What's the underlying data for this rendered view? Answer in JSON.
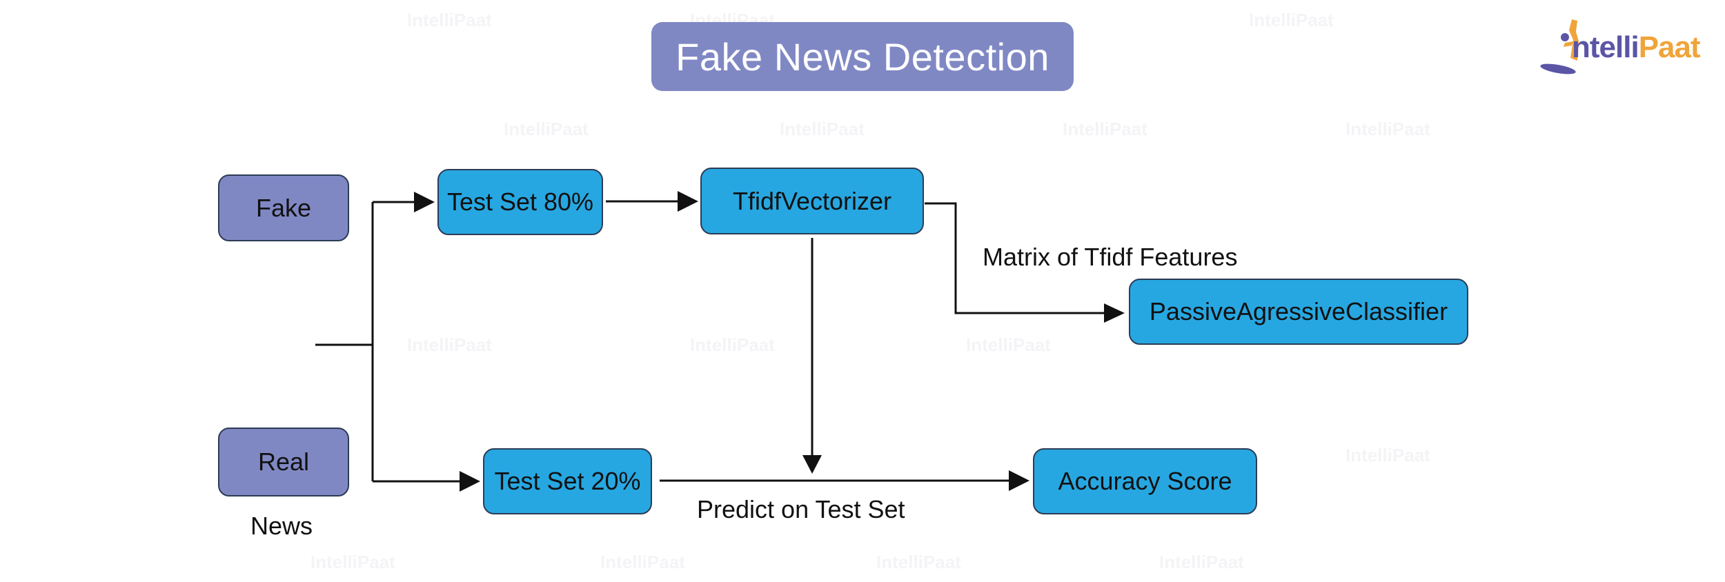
{
  "title": "Fake News Detection",
  "logo": {
    "part1": "ntelli",
    "part2": "Paat",
    "initial_icon": "person-figure-icon"
  },
  "colors": {
    "title_bg": "#8088c4",
    "source_node": "#8088c4",
    "step_node": "#27a7e1",
    "line": "#111111",
    "logo_purple": "#5b55a6",
    "logo_orange": "#f0a43a"
  },
  "nodes": {
    "fake": "Fake",
    "real": "Real",
    "train_set": "Test Set 80%",
    "test_set": "Test Set 20%",
    "vectorizer": "TfidfVectorizer",
    "classifier": "PassiveAgressiveClassifier",
    "accuracy": "Accuracy Score"
  },
  "labels": {
    "news": "News",
    "matrix": "Matrix of Tfidf Features",
    "predict": "Predict on Test Set"
  },
  "edges": [
    {
      "from": "news",
      "to": "train_set"
    },
    {
      "from": "news",
      "to": "test_set"
    },
    {
      "from": "train_set",
      "to": "vectorizer"
    },
    {
      "from": "vectorizer",
      "to": "classifier",
      "label": "Matrix of Tfidf Features"
    },
    {
      "from": "vectorizer",
      "to": "predict-line"
    },
    {
      "from": "test_set",
      "to": "accuracy",
      "label": "Predict on Test Set"
    }
  ],
  "watermark": "IntelliPaat"
}
